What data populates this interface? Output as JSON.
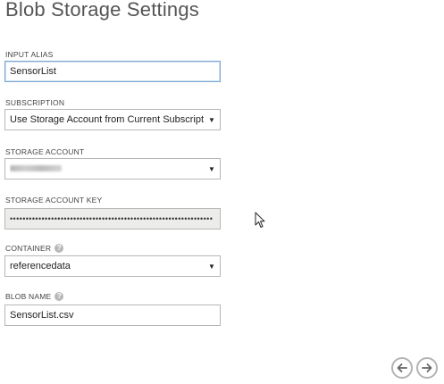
{
  "page": {
    "title": "Blob Storage Settings"
  },
  "fields": {
    "input_alias": {
      "label": "INPUT ALIAS",
      "value": "SensorList"
    },
    "subscription": {
      "label": "SUBSCRIPTION",
      "value": "Use Storage Account from Current Subscription"
    },
    "storage_account": {
      "label": "STORAGE ACCOUNT",
      "value_redacted": true
    },
    "storage_account_key": {
      "label": "STORAGE ACCOUNT KEY",
      "value": "••••••••••••••••••••••••••••••••••••••••••••••••••••••••••••••••"
    },
    "container": {
      "label": "CONTAINER",
      "help_icon": "?",
      "value": "referencedata"
    },
    "blob_name": {
      "label": "BLOB NAME",
      "help_icon": "?",
      "value": "SensorList.csv"
    }
  },
  "icons": {
    "dropdown": "chevron-down-icon",
    "help": "help-icon",
    "back": "arrow-left-icon",
    "next": "arrow-right-icon",
    "cursor": "mouse-pointer-icon"
  },
  "colors": {
    "focus_border": "#7aa7d3",
    "readonly_bg": "#ececea",
    "title": "#555555"
  }
}
